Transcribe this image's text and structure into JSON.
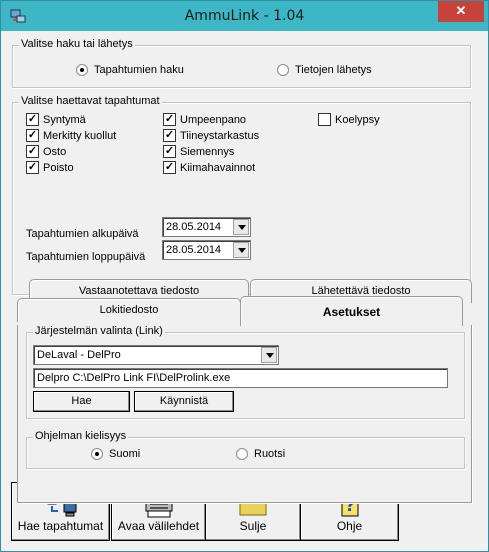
{
  "window": {
    "title": "AmmuLink - 1.04",
    "close_label": "✕"
  },
  "mode_group": {
    "legend": "Valitse haku tai lähetys",
    "options": [
      {
        "label": "Tapahtumien haku",
        "selected": true
      },
      {
        "label": "Tietojen lähetys",
        "selected": false
      }
    ]
  },
  "events_group": {
    "legend": "Valitse haettavat tapahtumat",
    "checks": [
      {
        "label": "Syntymä",
        "checked": true
      },
      {
        "label": "Merkitty kuollut",
        "checked": true
      },
      {
        "label": "Osto",
        "checked": true
      },
      {
        "label": "Poisto",
        "checked": true
      },
      {
        "label": "Umpeenpano",
        "checked": true
      },
      {
        "label": "Tiineystarkastus",
        "checked": true
      },
      {
        "label": "Siemennys",
        "checked": true
      },
      {
        "label": "Kiimahavainnot",
        "checked": true
      },
      {
        "label": "Koelypsy",
        "checked": false
      }
    ],
    "start_label": "Tapahtumien alkupäivä",
    "start_value": "28.05.2014",
    "end_label": "Tapahtumien loppupäivä",
    "end_value": "28.05.2014"
  },
  "tabs": {
    "back_row": [
      "Vastaanotettava tiedosto",
      "Lähetettävä tiedosto"
    ],
    "front_row": [
      "Lokitiedosto",
      "Asetukset"
    ],
    "active": "Asetukset"
  },
  "system_group": {
    "legend": "Järjestelmän valinta (Link)",
    "selected_system": "DeLaval - DelPro",
    "path": "Delpro C:\\DelPro Link FI\\DelProlink.exe",
    "search_button": "Hae",
    "start_button": "Käynnistä"
  },
  "language_group": {
    "legend": "Ohjelman kielisyys",
    "options": [
      {
        "label": "Suomi",
        "selected": true
      },
      {
        "label": "Ruotsi",
        "selected": false
      }
    ]
  },
  "bottom_buttons": [
    {
      "label": "Hae tapahtumat",
      "icon": "network-computers-icon"
    },
    {
      "label": "Avaa välilehdet",
      "icon": "printer-lock-icon"
    },
    {
      "label": "Sulje",
      "icon": "folder-icon"
    },
    {
      "label": "Ohje",
      "icon": "help-icon"
    }
  ],
  "colors": {
    "titlebar": "#3db7c6",
    "close": "#c7423a",
    "face": "#f0f0f0"
  }
}
